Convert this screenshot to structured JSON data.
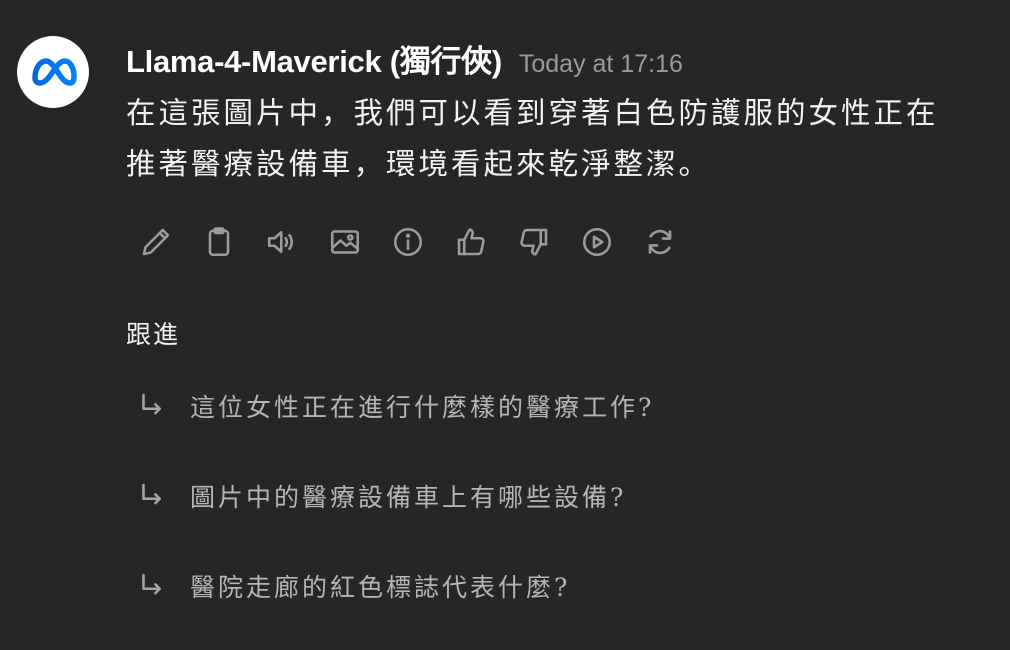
{
  "message": {
    "model_name": "Llama-4-Maverick (獨行俠)",
    "timestamp": "Today at 17:16",
    "text": "在這張圖片中，我們可以看到穿著白色防護服的女性正在推著醫療設備車，環境看起來乾淨整潔。"
  },
  "avatar": {
    "icon": "meta-logo-icon",
    "colors": [
      "#0668E1",
      "#0081FB"
    ]
  },
  "actions": [
    {
      "icon": "pencil-icon",
      "label": "Edit"
    },
    {
      "icon": "clipboard-icon",
      "label": "Copy"
    },
    {
      "icon": "speaker-icon",
      "label": "Read aloud"
    },
    {
      "icon": "image-icon",
      "label": "Generate image"
    },
    {
      "icon": "info-icon",
      "label": "Info"
    },
    {
      "icon": "thumbs-up-icon",
      "label": "Good response"
    },
    {
      "icon": "thumbs-down-icon",
      "label": "Bad response"
    },
    {
      "icon": "play-icon",
      "label": "Continue"
    },
    {
      "icon": "refresh-icon",
      "label": "Regenerate"
    }
  ],
  "followups": {
    "title": "跟進",
    "items": [
      "這位女性正在進行什麼樣的醫療工作?",
      "圖片中的醫療設備車上有哪些設備?",
      "醫院走廊的紅色標誌代表什麼?"
    ]
  },
  "colors": {
    "background": "#262626",
    "text_primary": "#F2F2F2",
    "text_secondary": "#9A9A9A",
    "icon": "#9B9B9B"
  }
}
